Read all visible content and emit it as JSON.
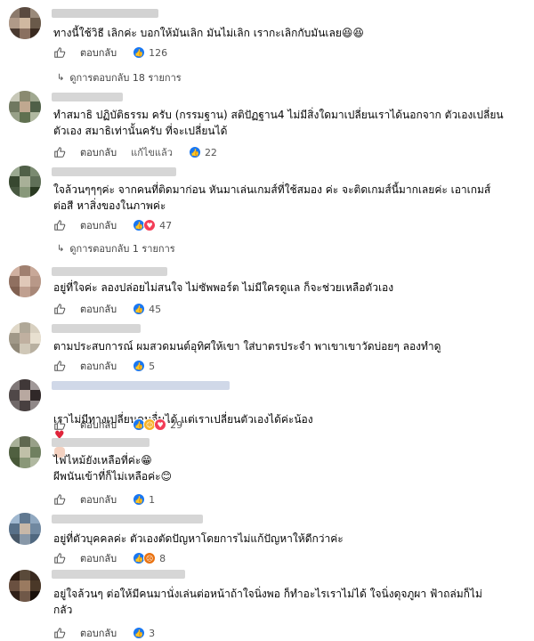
{
  "comments": [
    {
      "text": "ทางนี้ใช้วิธี เลิกค่ะ บอกให้มันเลิก มันไม่เลิก เรากะเลิกกับมันเลย😆😆",
      "reply": "ตอบกลับ",
      "count": "126",
      "reactions": [
        "like"
      ]
    },
    {
      "text": "ทำสมาธิ ปฏิบัติธรรม ครับ (กรรมฐาน) สติปัฏฐาน4 ไม่มีสิ่งใดมาเปลี่ยนเราได้นอกจาก ตัวเองเปลี่ยน\nตัวเอง สมาธิเท่านั้นครับ ที่จะเปลี่ยนได้",
      "reply": "ตอบกลับ",
      "edited": "แก้ไขแล้ว",
      "count": "22",
      "reactions": [
        "like"
      ]
    },
    {
      "text": "ใจล้วนๆๆๆค่ะ จากคนที่ติดมาก่อน หันมาเล่นเกมส์ที่ใช้สมอง ค่ะ จะติดเกมส์นี้มากเลยค่ะ เอาเกมส์\nต่อสี หาสิ่งของในภาพค่ะ",
      "reply": "ตอบกลับ",
      "count": "47",
      "reactions": [
        "like",
        "love"
      ]
    },
    {
      "text": "อยู่ที่ใจค่ะ ลองปล่อยไม่สนใจ ไม่ซัพพอร์ต ไม่มีใครดูแล ก็จะช่วยเหลือตัวเอง",
      "reply": "ตอบกลับ",
      "count": "45",
      "reactions": [
        "like"
      ]
    },
    {
      "text": "ตามประสบการณ์ ผมสวดมนต์อุทิศให้เขา ใส่บาตรประจำ พาเขาเขาวัดบ่อยๆ ลองทำดู",
      "reply": "ตอบกลับ",
      "count": "5",
      "reactions": [
        "like"
      ]
    },
    {
      "text": "เราไม่มีทางเปลี่ยนคนอื่นได้ แต่เราเปลี่ยนตัวเองได้ค่ะน้อง",
      "reply": "ตอบกลับ",
      "count": "29",
      "reactions": [
        "like",
        "haha",
        "love"
      ]
    },
    {
      "text": "ไฟไหม้ยังเหลือที่ค่ะ😁\nผีพนันเข้าที่ก็ไม่เหลือค่ะ😊",
      "reply": "ตอบกลับ",
      "count": "1",
      "reactions": [
        "like"
      ]
    },
    {
      "text": "อยู่ที่ตัวบุคคลค่ะ ตัวเองตัดปัญหาโดยการไม่แก้ปัญหาให้ดีกว่าค่ะ",
      "reply": "ตอบกลับ",
      "count": "8",
      "reactions": [
        "like",
        "angry"
      ]
    },
    {
      "text": "อยู่ใจล้วนๆ ต่อให้มีคนมานั่งเล่นต่อหน้าถ้าใจนิ่งพอ ก็ทำอะไรเราไม่ได้ ใจนิ่งดุจภูผา ฟ้าถล่มก็ไม่\nกลัว",
      "reply": "ตอบกลับ",
      "count": "3",
      "reactions": [
        "like"
      ]
    }
  ],
  "view_replies": [
    {
      "label": "ดูการตอบกลับ 18 รายการ"
    },
    {
      "label": "ดูการตอบกลับ 1 รายการ"
    }
  ],
  "colors": {
    "like": "#1877f2",
    "love": "#f33e58",
    "haha": "#f7b125",
    "angry": "#e9710f"
  },
  "icons": {
    "like_action": "thumbs-up-outline-icon",
    "reply_arrow": "reply-arrow-icon"
  }
}
